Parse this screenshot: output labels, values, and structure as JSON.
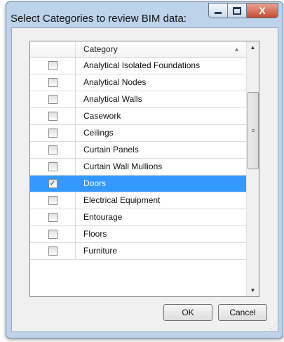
{
  "window": {
    "title": "Select Categories to review BIM data:",
    "controls": {
      "minimize": "–",
      "maximize": "□",
      "close": "X"
    }
  },
  "grid": {
    "header": {
      "category": "Category",
      "sort_icon": "▲"
    },
    "rows": [
      {
        "checked": false,
        "selected": false,
        "label": "Analytical Isolated Foundations"
      },
      {
        "checked": false,
        "selected": false,
        "label": "Analytical Nodes"
      },
      {
        "checked": false,
        "selected": false,
        "label": "Analytical Walls"
      },
      {
        "checked": false,
        "selected": false,
        "label": "Casework"
      },
      {
        "checked": false,
        "selected": false,
        "label": "Ceilings"
      },
      {
        "checked": false,
        "selected": false,
        "label": "Curtain Panels"
      },
      {
        "checked": false,
        "selected": false,
        "label": "Curtain Wall Mullions"
      },
      {
        "checked": true,
        "selected": true,
        "label": "Doors"
      },
      {
        "checked": false,
        "selected": false,
        "label": "Electrical Equipment"
      },
      {
        "checked": false,
        "selected": false,
        "label": "Entourage"
      },
      {
        "checked": false,
        "selected": false,
        "label": "Floors"
      },
      {
        "checked": false,
        "selected": false,
        "label": "Furniture"
      }
    ],
    "scrollbar": {
      "up_icon": "▲",
      "down_icon": "▼",
      "grip_icon": "≡"
    }
  },
  "buttons": {
    "ok": "OK",
    "cancel": "Cancel"
  },
  "colors": {
    "selection": "#3399ff",
    "frame": "#bcd3ea",
    "close": "#c84a32"
  },
  "icons": {
    "check": "✓",
    "resize_grip": "⋰"
  }
}
